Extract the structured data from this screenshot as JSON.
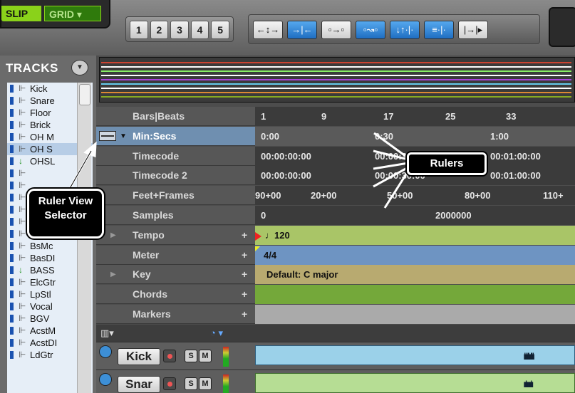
{
  "toolbar": {
    "modes": {
      "slip": "SLIP",
      "grid": "GRID"
    },
    "grid_arrow": "▾",
    "numbers": [
      "1",
      "2",
      "3",
      "4",
      "5"
    ],
    "tools": [
      {
        "glyph": "←↕→",
        "active": false
      },
      {
        "glyph": "→|←",
        "active": true
      },
      {
        "glyph": "▫→▫",
        "active": false
      },
      {
        "glyph": "▫↝▫",
        "active": true
      },
      {
        "glyph": "↓↑·|·",
        "active": true
      },
      {
        "glyph": "≡·|·",
        "active": true
      },
      {
        "glyph": "|→|▸",
        "active": false
      }
    ]
  },
  "tracks": {
    "title": "TRACKS",
    "items": [
      {
        "name": "Kick",
        "icon": "fader-icon",
        "selected": false
      },
      {
        "name": "Snare",
        "icon": "fader-icon",
        "selected": false
      },
      {
        "name": "Floor",
        "icon": "fader-icon",
        "selected": false
      },
      {
        "name": "Brick",
        "icon": "fader-icon",
        "selected": false
      },
      {
        "name": "OH M",
        "icon": "fader-icon",
        "selected": false
      },
      {
        "name": "OH S",
        "icon": "fader-icon",
        "selected": true
      },
      {
        "name": "OHSL",
        "icon": "input-arrow-icon",
        "selected": false
      },
      {
        "name": "",
        "icon": "fader-icon",
        "selected": false
      },
      {
        "name": "",
        "icon": "fader-icon",
        "selected": false
      },
      {
        "name": "",
        "icon": "fader-icon",
        "selected": false
      },
      {
        "name": "",
        "icon": "fader-icon",
        "selected": false
      },
      {
        "name": "",
        "icon": "fader-icon",
        "selected": false
      },
      {
        "name": "",
        "icon": "fader-icon",
        "selected": false
      },
      {
        "name": "BsMc",
        "icon": "fader-icon",
        "selected": false
      },
      {
        "name": "BasDI",
        "icon": "fader-icon",
        "selected": false
      },
      {
        "name": "BASS",
        "icon": "input-arrow-icon",
        "selected": false
      },
      {
        "name": "ElcGtr",
        "icon": "fader-icon",
        "selected": false
      },
      {
        "name": "LpStl",
        "icon": "fader-icon",
        "selected": false
      },
      {
        "name": "Vocal",
        "icon": "fader-icon",
        "selected": false
      },
      {
        "name": "BGV",
        "icon": "fader-icon",
        "selected": false
      },
      {
        "name": "AcstM",
        "icon": "fader-icon",
        "selected": false
      },
      {
        "name": "AcstDI",
        "icon": "fader-icon",
        "selected": false
      },
      {
        "name": "LdGtr",
        "icon": "fader-icon",
        "selected": false
      }
    ]
  },
  "rulers": [
    {
      "label": "Bars|Beats",
      "ticks": [
        "1",
        "9",
        "17",
        "25",
        "33"
      ],
      "lane": "dark"
    },
    {
      "label": "Min:Secs",
      "ticks": [
        "0:00",
        "0:30",
        "1:00"
      ],
      "lane": "dark",
      "selected": true
    },
    {
      "label": "Timecode",
      "ticks": [
        "00:00:00:00",
        "00:00:30:00",
        "00:01:00:00"
      ],
      "lane": "dark"
    },
    {
      "label": "Timecode 2",
      "ticks": [
        "00:00:00:00",
        "00:00:30:00",
        "00:01:00:00"
      ],
      "lane": "dark"
    },
    {
      "label": "Feet+Frames",
      "ticks": [
        "90+00",
        "20+00",
        "50+00",
        "80+00",
        "110+"
      ],
      "lane": "dark"
    },
    {
      "label": "Samples",
      "ticks": [
        "0",
        "2000000"
      ],
      "lane": "dark"
    },
    {
      "label": "Tempo",
      "ticks": [
        "♩120"
      ],
      "lane": "tempo",
      "plus": "+"
    },
    {
      "label": "Meter",
      "ticks": [
        "4/4"
      ],
      "lane": "meter",
      "plus": "+"
    },
    {
      "label": "Key",
      "ticks": [
        "Default: C major"
      ],
      "lane": "key",
      "plus": "+"
    },
    {
      "label": "Chords",
      "ticks": [],
      "lane": "chords",
      "plus": "+"
    },
    {
      "label": "Markers",
      "ticks": [],
      "lane": "markers",
      "plus": "+"
    }
  ],
  "edit_tracks": [
    {
      "name": "Kick",
      "solo": "S",
      "mute": "M"
    },
    {
      "name": "Snar",
      "solo": "S",
      "mute": "M"
    }
  ],
  "annotations": {
    "view_selector": "Ruler View Selector",
    "rulers": "Rulers"
  },
  "colors": {
    "slip_mode": "#8ad21a",
    "selected_ruler": "#6f8fb0",
    "tempo_lane": "#a9c567",
    "meter_lane": "#6e94c2",
    "key_lane": "#b8aa70",
    "chords_lane": "#74a83a",
    "clip": "#9bd1e9"
  }
}
